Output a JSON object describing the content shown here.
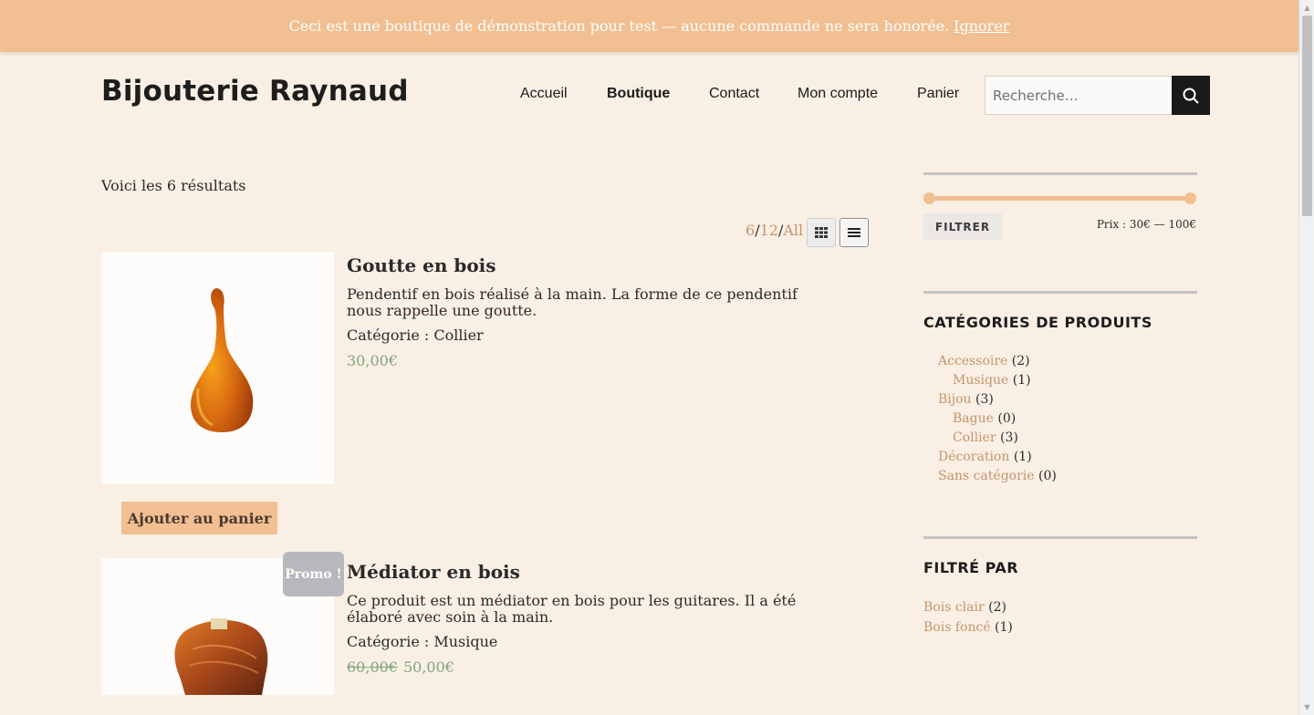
{
  "banner": {
    "text": "Ceci est une boutique de démonstration pour test — aucune commande ne sera honorée.",
    "dismiss": "Ignorer"
  },
  "header": {
    "site_title": "Bijouterie Raynaud",
    "nav": [
      "Accueil",
      "Boutique",
      "Contact",
      "Mon compte",
      "Panier"
    ],
    "active_nav": "Boutique",
    "search_placeholder": "Recherche…"
  },
  "shop": {
    "result_count": "Voici les 6 résultats",
    "per_page": {
      "current": "6",
      "option2": "12",
      "option3": "All"
    },
    "products": [
      {
        "title": "Goutte en bois",
        "description": "Pendentif en bois réalisé à la main. La forme de ce pendentif nous rappelle une goutte.",
        "category": "Catégorie : Collier",
        "price": "30,00€",
        "button": "Ajouter au panier"
      },
      {
        "title": "Médiator en bois",
        "description": "Ce produit est un médiator en bois pour les guitares. Il a été élaboré avec soin à la main.",
        "category": "Catégorie : Musique",
        "old_price": "60,00€",
        "price": "50,00€",
        "badge": "Promo !"
      }
    ]
  },
  "sidebar": {
    "price_filter": {
      "button": "FILTRER",
      "range": "Prix : 30€ — 100€"
    },
    "categories_title": "CATÉGORIES DE PRODUITS",
    "categories": [
      {
        "name": "Accessoire",
        "count": "(2)",
        "sub": false
      },
      {
        "name": "Musique",
        "count": "(1)",
        "sub": true
      },
      {
        "name": "Bijou",
        "count": "(3)",
        "sub": false
      },
      {
        "name": "Bague",
        "count": "(0)",
        "sub": true
      },
      {
        "name": "Collier",
        "count": "(3)",
        "sub": true
      },
      {
        "name": "Décoration",
        "count": "(1)",
        "sub": false
      },
      {
        "name": "Sans catégorie",
        "count": "(0)",
        "sub": false
      }
    ],
    "filtered_title": "FILTRÉ PAR",
    "filters": [
      {
        "name": "Bois clair",
        "count": "(2)"
      },
      {
        "name": "Bois foncé",
        "count": "(1)"
      }
    ]
  },
  "colors": {
    "accent": "#f1bf91",
    "link": "#c6946b",
    "price": "#7ea67c",
    "background": "#f9efe4"
  }
}
